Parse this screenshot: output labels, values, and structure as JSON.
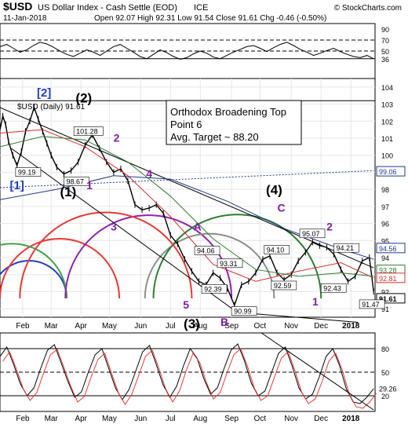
{
  "header": {
    "symbol": "$USD",
    "name": "US Dollar Index - Cash Settle (EOD)",
    "exchange": "ICE",
    "date": "11-Jan-2018",
    "ohlc": "Open 92.07  High 92.31  Low 91.54  Close 91.61  Chg -0.46 (-0.50%)",
    "watermark": "© StockCharts.com"
  },
  "chart_data": {
    "type": "line",
    "title": "$USD US Dollar Index - Cash Settle (EOD) ICE",
    "price_panel": {
      "legend": "$USD (Daily) 91.61",
      "ylim": [
        90.5,
        104.5
      ],
      "ticks": [
        91,
        92,
        93,
        94,
        95,
        96,
        97,
        98,
        99,
        100,
        101,
        102,
        103,
        104
      ],
      "series": [
        {
          "name": "$USD (Daily)",
          "color": "#000000",
          "x": [
            0,
            2,
            4,
            6,
            9,
            12,
            15,
            18,
            21,
            24,
            27,
            30,
            33,
            36,
            40,
            45,
            50,
            55,
            60,
            65,
            70,
            75,
            80,
            85,
            90,
            95,
            100,
            105,
            110,
            115,
            120,
            125,
            130,
            135,
            140,
            145,
            150,
            155,
            160,
            165,
            170,
            175,
            180,
            185,
            190,
            195,
            200,
            205,
            210,
            215,
            220,
            225,
            230,
            235,
            240,
            245,
            250,
            255,
            260,
            263
          ],
          "values": [
            101.5,
            102.3,
            101.8,
            100.8,
            100.0,
            99.4,
            100.2,
            101.4,
            102.0,
            102.8,
            102.1,
            101.4,
            100.7,
            100.0,
            99.3,
            98.9,
            99.1,
            99.6,
            100.6,
            101.2,
            100.4,
            99.6,
            99.0,
            99.2,
            98.5,
            97.1,
            96.8,
            96.9,
            97.1,
            96.6,
            95.3,
            94.8,
            93.9,
            93.2,
            92.6,
            92.4,
            93.1,
            92.8,
            92.2,
            91.2,
            92.4,
            92.6,
            93.1,
            93.9,
            94.1,
            93.1,
            92.7,
            93.0,
            93.8,
            94.3,
            94.9,
            94.7,
            94.6,
            94.2,
            93.3,
            92.6,
            92.9,
            93.8,
            94.0,
            92.0
          ]
        },
        {
          "name": "Moving average (short)",
          "color": "#d32f2f",
          "x": [
            0,
            30,
            60,
            90,
            120,
            150,
            180,
            210,
            240,
            263
          ],
          "values": [
            101.3,
            101.5,
            100.5,
            98.8,
            96.4,
            93.6,
            92.6,
            93.2,
            93.7,
            92.8
          ]
        },
        {
          "name": "Moving average (medium)",
          "color": "#2e7d32",
          "x": [
            0,
            30,
            60,
            90,
            120,
            150,
            180,
            210,
            240,
            263
          ],
          "values": [
            100.5,
            101.1,
            100.9,
            99.6,
            97.6,
            95.1,
            93.3,
            92.9,
            93.1,
            92.9
          ]
        },
        {
          "name": "Moving average (long)",
          "color": "#1e3a8a",
          "x": [
            0,
            40,
            80,
            120,
            160,
            200,
            240,
            263
          ],
          "values": [
            97.4,
            98.0,
            98.8,
            98.6,
            97.3,
            95.7,
            94.5,
            93.9
          ]
        }
      ],
      "last_values": [
        {
          "label": "99.06",
          "color": "#1e3a8a",
          "value": 99.06
        },
        {
          "label": "94.56",
          "color": "#1e3a8a",
          "value": 94.56
        },
        {
          "label": "93.28",
          "color": "#2e7d32",
          "value": 93.28
        },
        {
          "label": "92.81",
          "color": "#d32f2f",
          "value": 92.81
        },
        {
          "label": "91.61",
          "color": "#000000",
          "value": 91.61
        }
      ],
      "price_labels": [
        {
          "text": "101.28",
          "x": 52,
          "y": 101.3
        },
        {
          "text": "99.19",
          "x": 11,
          "y": 98.9
        },
        {
          "text": "98.67",
          "x": 45,
          "y": 98.35
        },
        {
          "text": "94.06",
          "x": 137,
          "y": 94.3
        },
        {
          "text": "93.31",
          "x": 153,
          "y": 93.55
        },
        {
          "text": "94.10",
          "x": 186,
          "y": 94.35
        },
        {
          "text": "95.07",
          "x": 211,
          "y": 95.3
        },
        {
          "text": "94.21",
          "x": 235,
          "y": 94.45
        },
        {
          "text": "92.39",
          "x": 142,
          "y": 92.05
        },
        {
          "text": "90.99",
          "x": 163,
          "y": 90.75
        },
        {
          "text": "92.59",
          "x": 191,
          "y": 92.25
        },
        {
          "text": "92.43",
          "x": 226,
          "y": 92.1
        },
        {
          "text": "91.47",
          "x": 253,
          "y": 91.15
        }
      ],
      "wave_labels": [
        {
          "text": "[1]",
          "x": 12,
          "y": 98.0,
          "color": "#1f3fbf",
          "size": 15
        },
        {
          "text": "[2]",
          "x": 31,
          "y": 103.45,
          "color": "#1f3fbf",
          "size": 15
        },
        {
          "text": "(1)",
          "x": 48,
          "y": 97.6,
          "color": "#000000",
          "size": 17
        },
        {
          "text": "(2)",
          "x": 59,
          "y": 103.1,
          "color": "#000000",
          "size": 17
        },
        {
          "text": "1",
          "x": 63,
          "y": 98.0,
          "color": "#7b1fa2",
          "size": 14
        },
        {
          "text": "2",
          "x": 82,
          "y": 100.8,
          "color": "#7b1fa2",
          "size": 14
        },
        {
          "text": "3",
          "x": 80,
          "y": 95.6,
          "color": "#7b1fa2",
          "size": 14
        },
        {
          "text": "4",
          "x": 105,
          "y": 98.7,
          "color": "#7b1fa2",
          "size": 14
        },
        {
          "text": "5",
          "x": 131,
          "y": 91.0,
          "color": "#7b1fa2",
          "size": 14
        },
        {
          "text": "A",
          "x": 139,
          "y": 95.6,
          "color": "#7b1fa2",
          "size": 14
        },
        {
          "text": "(4)",
          "x": 193,
          "y": 97.7,
          "color": "#000000",
          "size": 17
        },
        {
          "text": "C",
          "x": 198,
          "y": 96.7,
          "color": "#7b1fa2",
          "size": 14
        },
        {
          "text": "2",
          "x": 232,
          "y": 95.6,
          "color": "#7b1fa2",
          "size": 14
        },
        {
          "text": "1",
          "x": 222,
          "y": 91.2,
          "color": "#7b1fa2",
          "size": 14
        }
      ],
      "annotation": [
        "Orthodox Broadening Top",
        "Point 6",
        "Avg. Target ~ 88.20"
      ]
    },
    "rsi_panel": {
      "ticks": [
        90,
        70,
        50,
        36.0
      ],
      "last_value_label": "36.00",
      "ylim": [
        0,
        100
      ],
      "values": [
        58,
        62,
        55,
        48,
        52,
        60,
        66,
        63,
        57,
        50,
        44,
        40,
        46,
        52,
        48,
        42,
        50,
        58,
        62,
        55,
        48,
        40,
        36,
        44,
        52,
        47,
        40,
        35,
        38,
        45,
        50,
        46,
        39,
        36,
        42,
        48,
        53,
        58,
        60,
        55,
        49,
        56,
        62,
        66,
        60,
        53,
        48,
        42,
        46,
        51,
        55,
        49,
        44,
        40,
        38,
        42,
        36
      ]
    },
    "stoch_panel": {
      "ticks": [
        80,
        50,
        20
      ],
      "last_value_label": "29.26",
      "ylim": [
        0,
        100
      ],
      "values": [
        70,
        82,
        60,
        35,
        20,
        30,
        55,
        78,
        85,
        62,
        38,
        18,
        25,
        50,
        72,
        80,
        55,
        30,
        15,
        28,
        52,
        76,
        84,
        60,
        34,
        18,
        32,
        58,
        80,
        68,
        42,
        22,
        30,
        55,
        78,
        86,
        64,
        36,
        20,
        26,
        50,
        74,
        82,
        58,
        30,
        16,
        22,
        44,
        70,
        80,
        58,
        28,
        12,
        10,
        18,
        29
      ]
    },
    "x_axis": {
      "months": [
        {
          "label": "Feb",
          "x": 16
        },
        {
          "label": "Mar",
          "x": 36
        },
        {
          "label": "Apr",
          "x": 57
        },
        {
          "label": "May",
          "x": 77
        },
        {
          "label": "Jun",
          "x": 99
        },
        {
          "label": "Jul",
          "x": 120
        },
        {
          "label": "Aug",
          "x": 141
        },
        {
          "label": "Sep",
          "x": 163
        },
        {
          "label": "Oct",
          "x": 183
        },
        {
          "label": "Nov",
          "x": 205
        },
        {
          "label": "Dec",
          "x": 226
        },
        {
          "label": "2018",
          "x": 247
        }
      ],
      "range": [
        0,
        264
      ]
    },
    "wave_label_lower": {
      "text": "(3)",
      "x": 135,
      "color": "#000000"
    },
    "wave_label_b": {
      "text": "B",
      "x": 158,
      "color": "#7b1fa2"
    },
    "cycle_arcs": [
      {
        "color": "#1f3fbf",
        "x0": -6,
        "x1": 47
      },
      {
        "color": "#e53935",
        "x0": 0,
        "x1": 84
      },
      {
        "color": "#43a047",
        "x0": -30,
        "x1": 47
      },
      {
        "color": "#8e24aa",
        "x0": 46,
        "x1": 163
      },
      {
        "color": "#8d8d8d",
        "x0": 102,
        "x1": 193
      },
      {
        "color": "#2e7d32",
        "x0": 108,
        "x1": 226
      },
      {
        "color": "#e53935",
        "x0": 14,
        "x1": 135
      }
    ]
  }
}
